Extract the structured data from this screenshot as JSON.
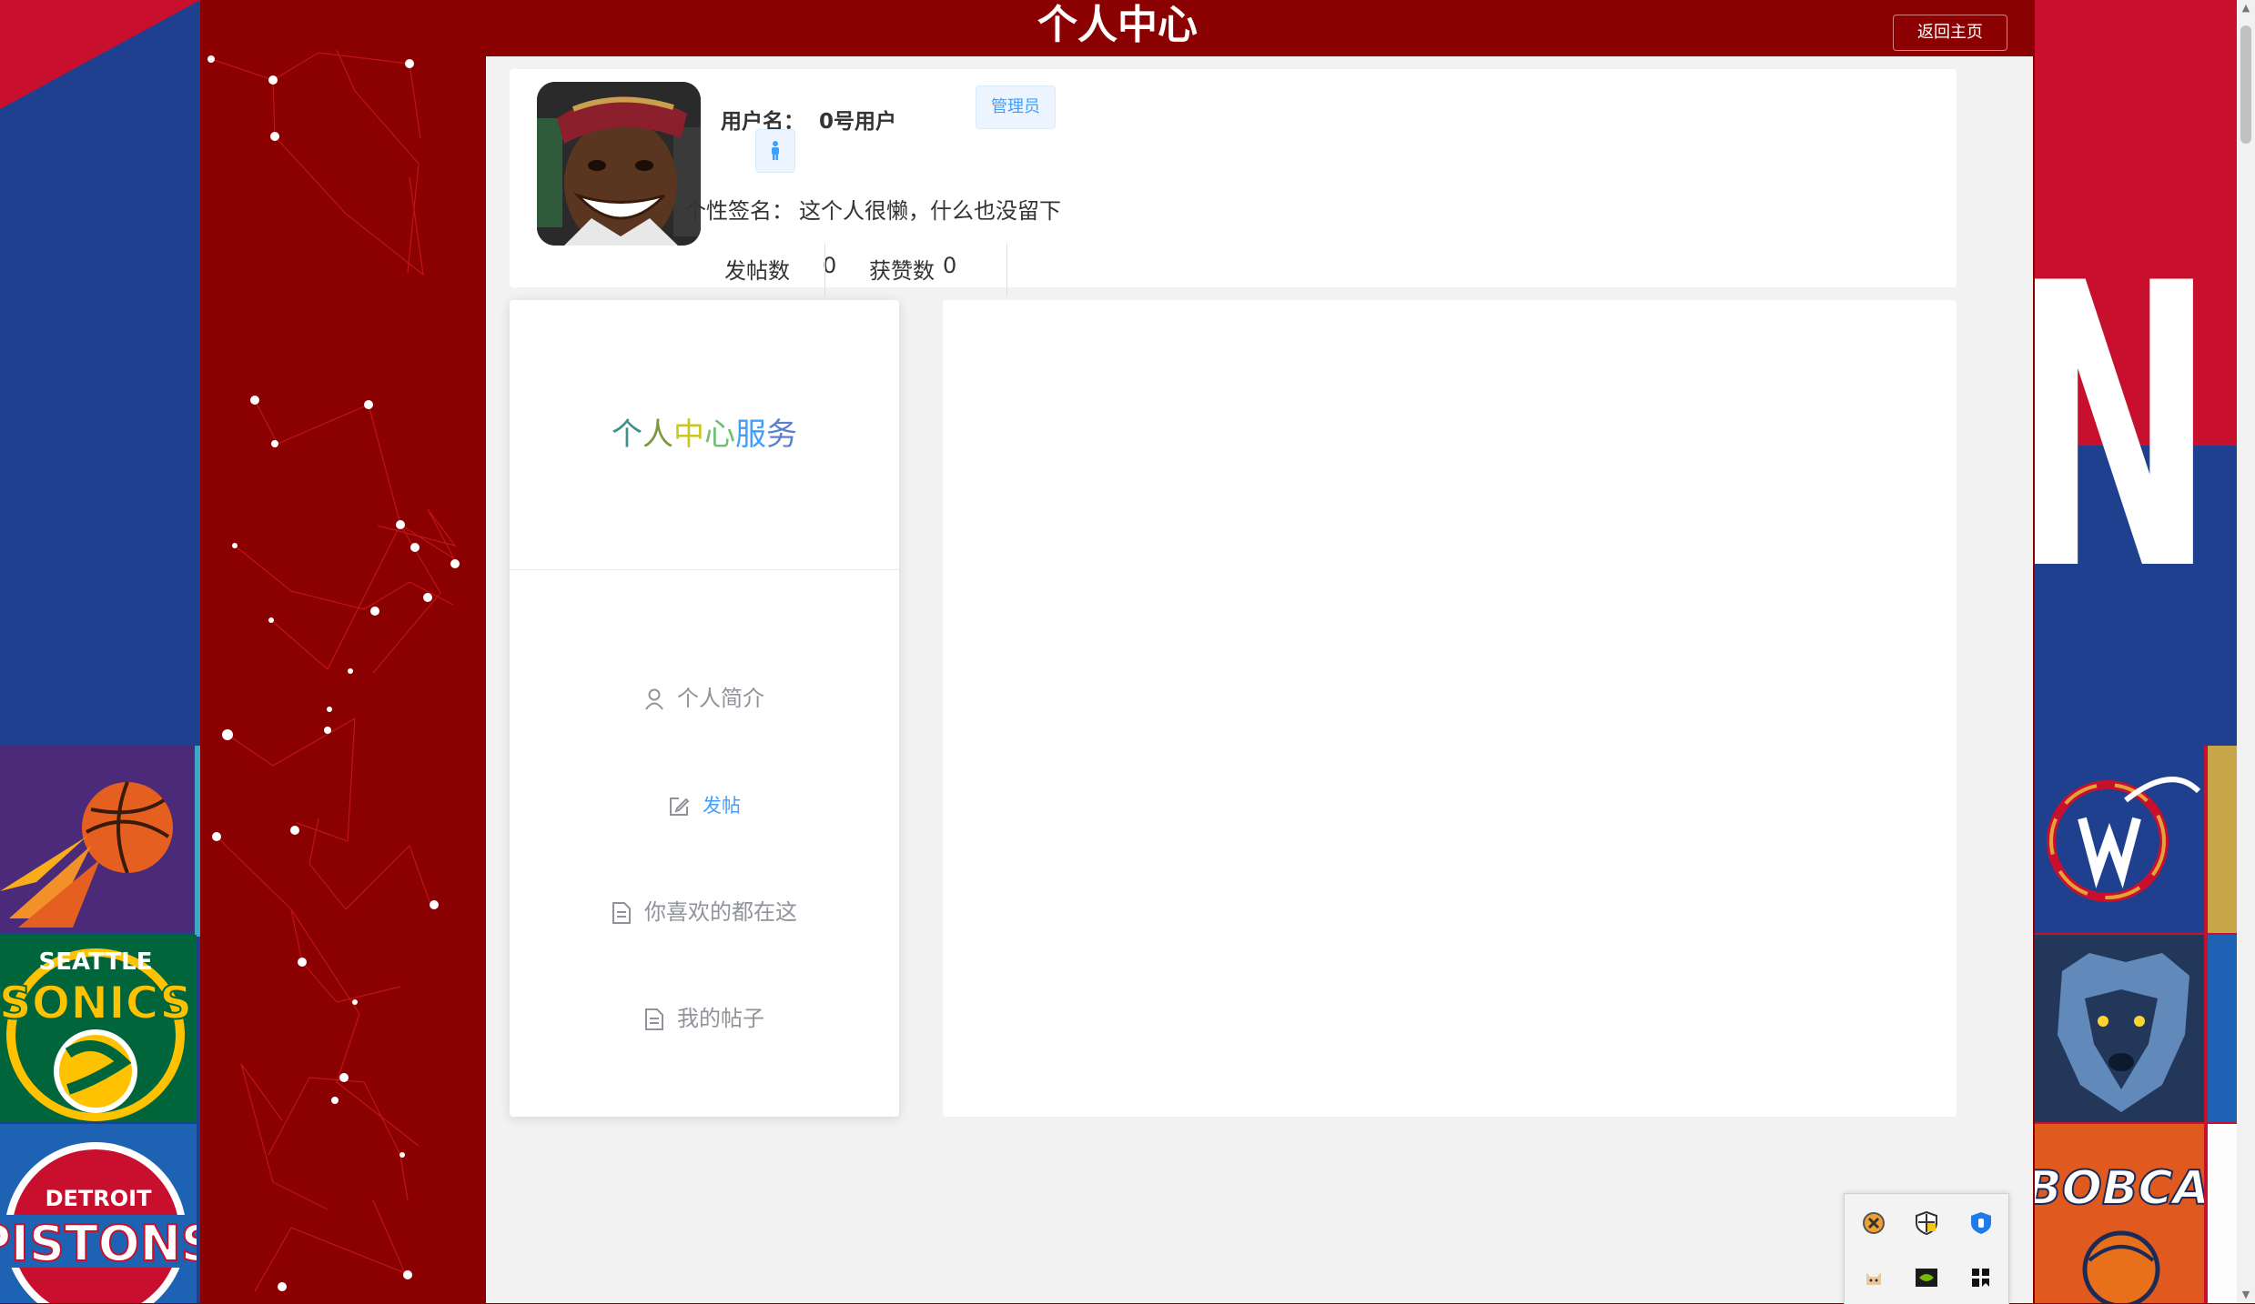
{
  "header": {
    "title": "个人中心",
    "back_button": "返回主页"
  },
  "profile": {
    "username_label": "用户名：",
    "username": "0号用户",
    "role_tag": "管理员",
    "gender_icon": "male-icon",
    "signature_label": "个性签名：",
    "signature": "这个人很懒，什么也没留下",
    "post_count_label": "发帖数",
    "post_count": "0",
    "like_count_label": "获赞数",
    "like_count": "0"
  },
  "service": {
    "title_chars": [
      "个",
      "人",
      "中",
      "心",
      "服",
      "务"
    ],
    "title_colors": [
      "#3f8f8a",
      "#7a9a3a",
      "#c9c61f",
      "#6fbf73",
      "#409eff",
      "#5a7fd1"
    ],
    "menu": [
      {
        "label": "个人简介",
        "icon": "user-icon"
      },
      {
        "label": "发帖",
        "icon": "edit-icon"
      },
      {
        "label": "你喜欢的都在这",
        "icon": "document-icon"
      },
      {
        "label": "我的帖子",
        "icon": "document-icon"
      }
    ],
    "active_menu": "发帖"
  },
  "background": {
    "left_team_logos": [
      "SEATTLE",
      "SONICS",
      "DETROIT",
      "PISTONS"
    ],
    "right_logo_text": "NB",
    "right_team_logos": [
      "BOBCATS"
    ]
  },
  "tray_icons": [
    "close-circle-icon",
    "shield-icon",
    "security-icon",
    "cat-icon",
    "nvidia-icon",
    "grid-icon"
  ],
  "colors": {
    "band_red": "#8b0000",
    "accent_blue": "#409eff",
    "nba_red": "#c8102e",
    "nba_blue": "#1f3f8f"
  }
}
